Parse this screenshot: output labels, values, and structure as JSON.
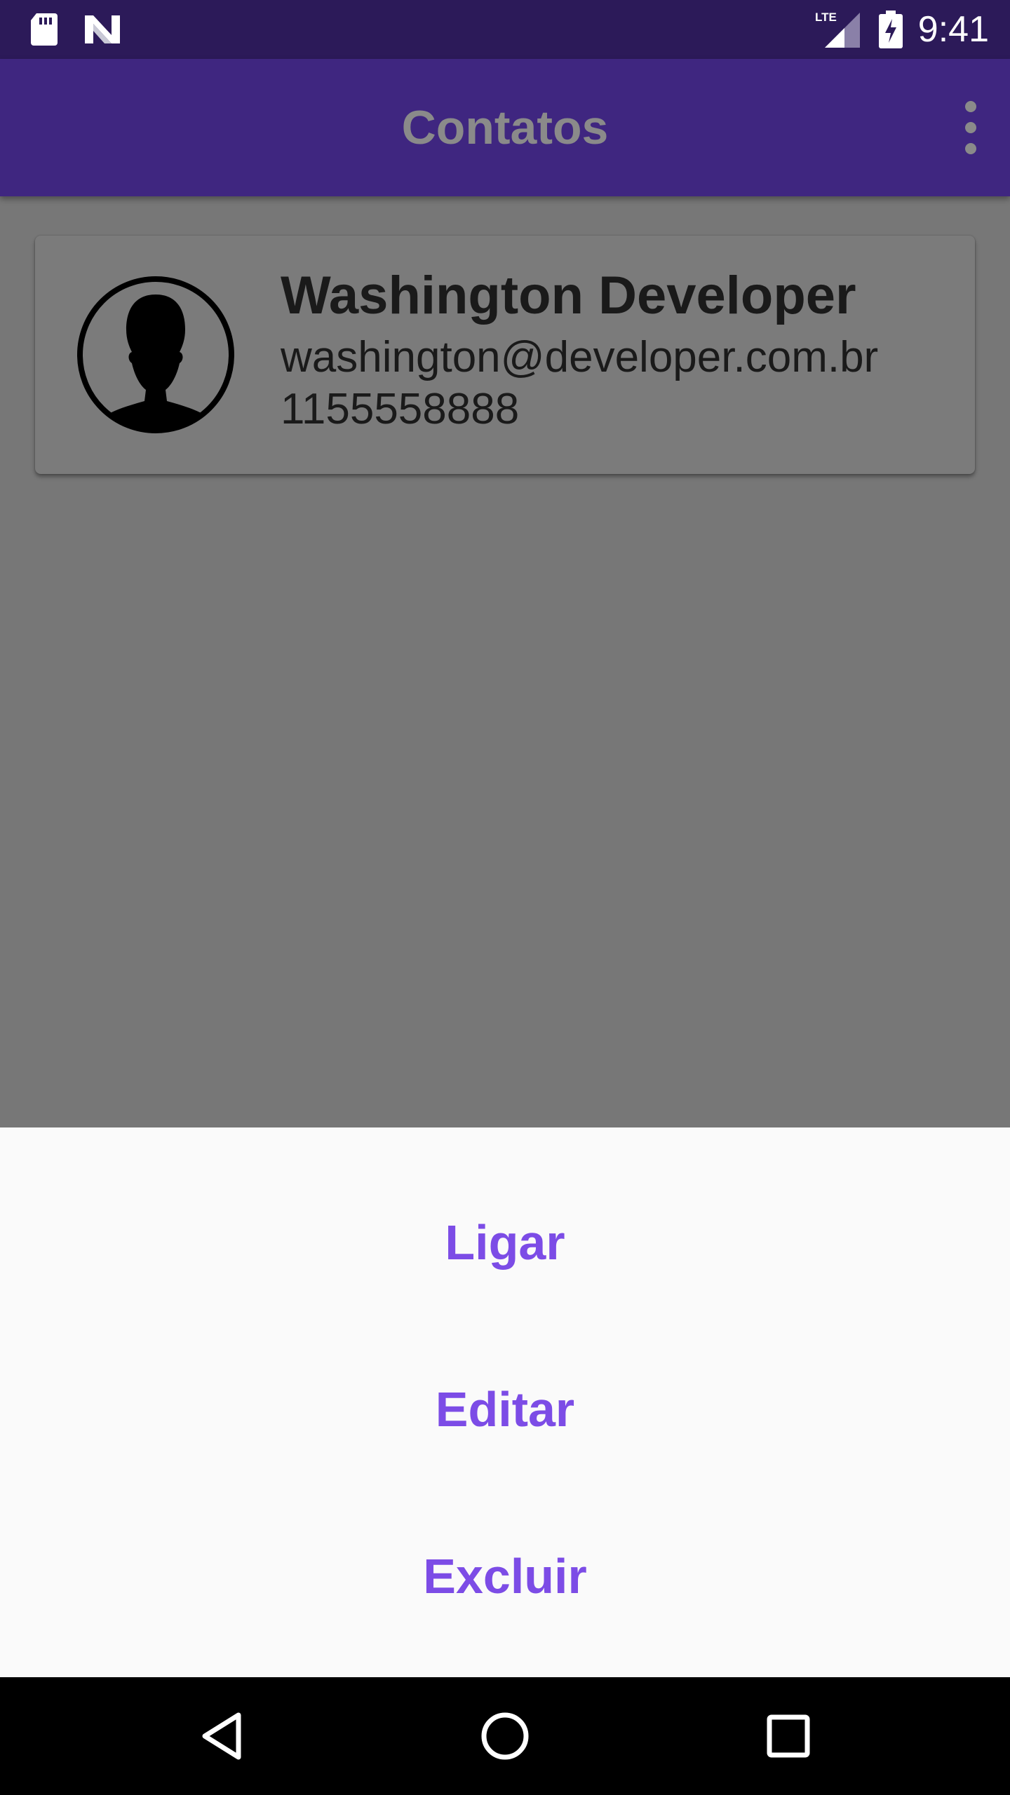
{
  "status_bar": {
    "time": "9:41",
    "network_label": "LTE",
    "icons": [
      "sd-card-icon",
      "n-notification-icon",
      "lte-signal-icon",
      "battery-charging-icon"
    ]
  },
  "app_bar": {
    "title": "Contatos",
    "menu_icon": "more-vert-icon"
  },
  "contacts": [
    {
      "name": "Washington Developer",
      "email": "washington@developer.com.br",
      "phone": "1155558888",
      "avatar_icon": "person-avatar-icon"
    }
  ],
  "bottom_sheet": {
    "options": [
      {
        "label": "Ligar"
      },
      {
        "label": "Editar"
      },
      {
        "label": "Excluir"
      }
    ]
  },
  "nav_bar": {
    "icons": [
      "back-icon",
      "home-icon",
      "recents-icon"
    ]
  },
  "colors": {
    "status_bar": "#2c1a59",
    "app_bar": "#3f2680",
    "scrim_content": "#777777",
    "sheet_background": "#fafafa",
    "sheet_text": "#7c4ce6",
    "nav_bar": "#000000"
  }
}
